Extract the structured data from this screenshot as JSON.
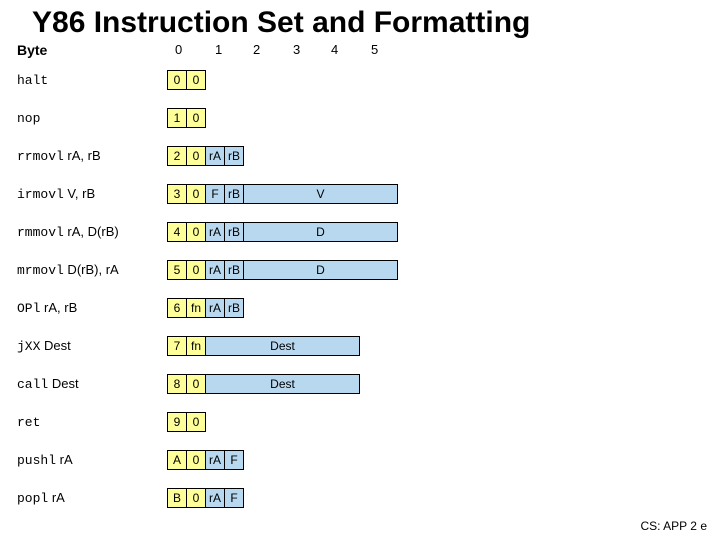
{
  "title": "Y86 Instruction Set and Formatting",
  "byte_label": "Byte",
  "byte_headers": [
    "0",
    "1",
    "2",
    "3",
    "4",
    "5"
  ],
  "footer": "CS: APP 2 e",
  "chart_data": {
    "type": "table",
    "title": "Y86 Instruction Encoding",
    "columns_bytes": [
      0,
      1,
      2,
      3,
      4,
      5
    ],
    "rows": [
      {
        "mnemonic": "halt",
        "operands": "",
        "encoding": [
          [
            "0",
            "0"
          ]
        ]
      },
      {
        "mnemonic": "nop",
        "operands": "",
        "encoding": [
          [
            "1",
            "0"
          ]
        ]
      },
      {
        "mnemonic": "rrmovl",
        "operands": "rA, rB",
        "encoding": [
          [
            "2",
            "0"
          ],
          [
            "rA",
            "rB"
          ]
        ]
      },
      {
        "mnemonic": "irmovl",
        "operands": "V, rB",
        "encoding": [
          [
            "3",
            "0"
          ],
          [
            "F",
            "rB"
          ],
          [
            "V"
          ]
        ]
      },
      {
        "mnemonic": "rmmovl",
        "operands": "rA, D(rB)",
        "encoding": [
          [
            "4",
            "0"
          ],
          [
            "rA",
            "rB"
          ],
          [
            "D"
          ]
        ]
      },
      {
        "mnemonic": "mrmovl",
        "operands": "D(rB), rA",
        "encoding": [
          [
            "5",
            "0"
          ],
          [
            "rA",
            "rB"
          ],
          [
            "D"
          ]
        ]
      },
      {
        "mnemonic": "OPl",
        "operands": "rA, rB",
        "encoding": [
          [
            "6",
            "fn"
          ],
          [
            "rA",
            "rB"
          ]
        ]
      },
      {
        "mnemonic": "jXX",
        "operands": "Dest",
        "encoding": [
          [
            "7",
            "fn"
          ],
          [
            "Dest"
          ]
        ]
      },
      {
        "mnemonic": "call",
        "operands": "Dest",
        "encoding": [
          [
            "8",
            "0"
          ],
          [
            "Dest"
          ]
        ]
      },
      {
        "mnemonic": "ret",
        "operands": "",
        "encoding": [
          [
            "9",
            "0"
          ]
        ]
      },
      {
        "mnemonic": "pushl",
        "operands": "rA",
        "encoding": [
          [
            "A",
            "0"
          ],
          [
            "rA",
            "F"
          ]
        ]
      },
      {
        "mnemonic": "popl",
        "operands": "rA",
        "encoding": [
          [
            "B",
            "0"
          ],
          [
            "rA",
            "F"
          ]
        ]
      }
    ]
  },
  "rows": [
    {
      "mnemonic": "halt",
      "args": "",
      "cells": [
        {
          "t": "0",
          "c": "yellow",
          "w": "half"
        },
        {
          "t": "0",
          "c": "yellow",
          "w": "half"
        }
      ]
    },
    {
      "mnemonic": "nop",
      "args": "",
      "cells": [
        {
          "t": "1",
          "c": "yellow",
          "w": "half"
        },
        {
          "t": "0",
          "c": "yellow",
          "w": "half"
        }
      ]
    },
    {
      "mnemonic": "rrmovl",
      "args": " rA, rB",
      "cells": [
        {
          "t": "2",
          "c": "yellow",
          "w": "half"
        },
        {
          "t": "0",
          "c": "yellow",
          "w": "half"
        },
        {
          "t": "rA",
          "c": "blue",
          "w": "half"
        },
        {
          "t": "rB",
          "c": "blue",
          "w": "half"
        }
      ]
    },
    {
      "mnemonic": "irmovl",
      "args": " V, rB",
      "cells": [
        {
          "t": "3",
          "c": "yellow",
          "w": "half"
        },
        {
          "t": "0",
          "c": "yellow",
          "w": "half"
        },
        {
          "t": "F",
          "c": "blue",
          "w": "half"
        },
        {
          "t": "rB",
          "c": "blue",
          "w": "half"
        },
        {
          "t": "V",
          "c": "blue",
          "w": "wide4"
        }
      ]
    },
    {
      "mnemonic": "rmmovl",
      "args": " rA, D(rB)",
      "cells": [
        {
          "t": "4",
          "c": "yellow",
          "w": "half"
        },
        {
          "t": "0",
          "c": "yellow",
          "w": "half"
        },
        {
          "t": "rA",
          "c": "blue",
          "w": "half"
        },
        {
          "t": "rB",
          "c": "blue",
          "w": "half"
        },
        {
          "t": "D",
          "c": "blue",
          "w": "wide4"
        }
      ]
    },
    {
      "mnemonic": "mrmovl",
      "args": " D(rB), rA",
      "cells": [
        {
          "t": "5",
          "c": "yellow",
          "w": "half"
        },
        {
          "t": "0",
          "c": "yellow",
          "w": "half"
        },
        {
          "t": "rA",
          "c": "blue",
          "w": "half"
        },
        {
          "t": "rB",
          "c": "blue",
          "w": "half"
        },
        {
          "t": "D",
          "c": "blue",
          "w": "wide4"
        }
      ]
    },
    {
      "mnemonic": "OPl",
      "args": " rA, rB",
      "cells": [
        {
          "t": "6",
          "c": "yellow",
          "w": "half"
        },
        {
          "t": "fn",
          "c": "yellow",
          "w": "half"
        },
        {
          "t": "rA",
          "c": "blue",
          "w": "half"
        },
        {
          "t": "rB",
          "c": "blue",
          "w": "half"
        }
      ]
    },
    {
      "mnemonic": "jXX",
      "args": " Dest",
      "cells": [
        {
          "t": "7",
          "c": "yellow",
          "w": "half"
        },
        {
          "t": "fn",
          "c": "yellow",
          "w": "half"
        },
        {
          "t": "Dest",
          "c": "blue",
          "w": "wide4"
        }
      ]
    },
    {
      "mnemonic": "call",
      "args": " Dest",
      "cells": [
        {
          "t": "8",
          "c": "yellow",
          "w": "half"
        },
        {
          "t": "0",
          "c": "yellow",
          "w": "half"
        },
        {
          "t": "Dest",
          "c": "blue",
          "w": "wide4"
        }
      ]
    },
    {
      "mnemonic": "ret",
      "args": "",
      "cells": [
        {
          "t": "9",
          "c": "yellow",
          "w": "half"
        },
        {
          "t": "0",
          "c": "yellow",
          "w": "half"
        }
      ]
    },
    {
      "mnemonic": "pushl",
      "args": " rA",
      "cells": [
        {
          "t": "A",
          "c": "yellow",
          "w": "half"
        },
        {
          "t": "0",
          "c": "yellow",
          "w": "half"
        },
        {
          "t": "rA",
          "c": "blue",
          "w": "half"
        },
        {
          "t": "F",
          "c": "blue",
          "w": "half"
        }
      ]
    },
    {
      "mnemonic": "popl",
      "args": " rA",
      "cells": [
        {
          "t": "B",
          "c": "yellow",
          "w": "half"
        },
        {
          "t": "0",
          "c": "yellow",
          "w": "half"
        },
        {
          "t": "rA",
          "c": "blue",
          "w": "half"
        },
        {
          "t": "F",
          "c": "blue",
          "w": "half"
        }
      ]
    }
  ]
}
